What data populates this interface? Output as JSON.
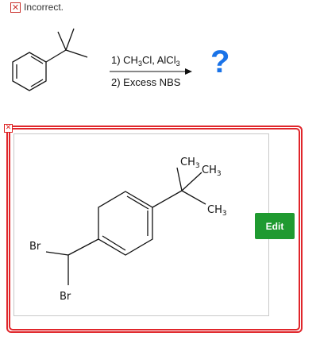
{
  "feedback": {
    "status_text": "Incorrect.",
    "status_icon": "x-box-icon",
    "status_color": "#c9302c"
  },
  "reaction": {
    "step1_prefix": "1) CH",
    "step1_sub1": "3",
    "step1_mid": "Cl, AlCl",
    "step1_sub2": "3",
    "step2": "2) Excess NBS",
    "unknown": "?"
  },
  "answer": {
    "ch3_top_a": "CH",
    "ch3_top_a_sub": "3",
    "ch3_top_b": "CH",
    "ch3_top_b_sub": "3",
    "ch3_right": "CH",
    "ch3_right_sub": "3",
    "br1": "Br",
    "br2": "Br",
    "edit_label": "Edit",
    "frame_color": "#e0262b",
    "edit_color": "#1f9a30"
  }
}
